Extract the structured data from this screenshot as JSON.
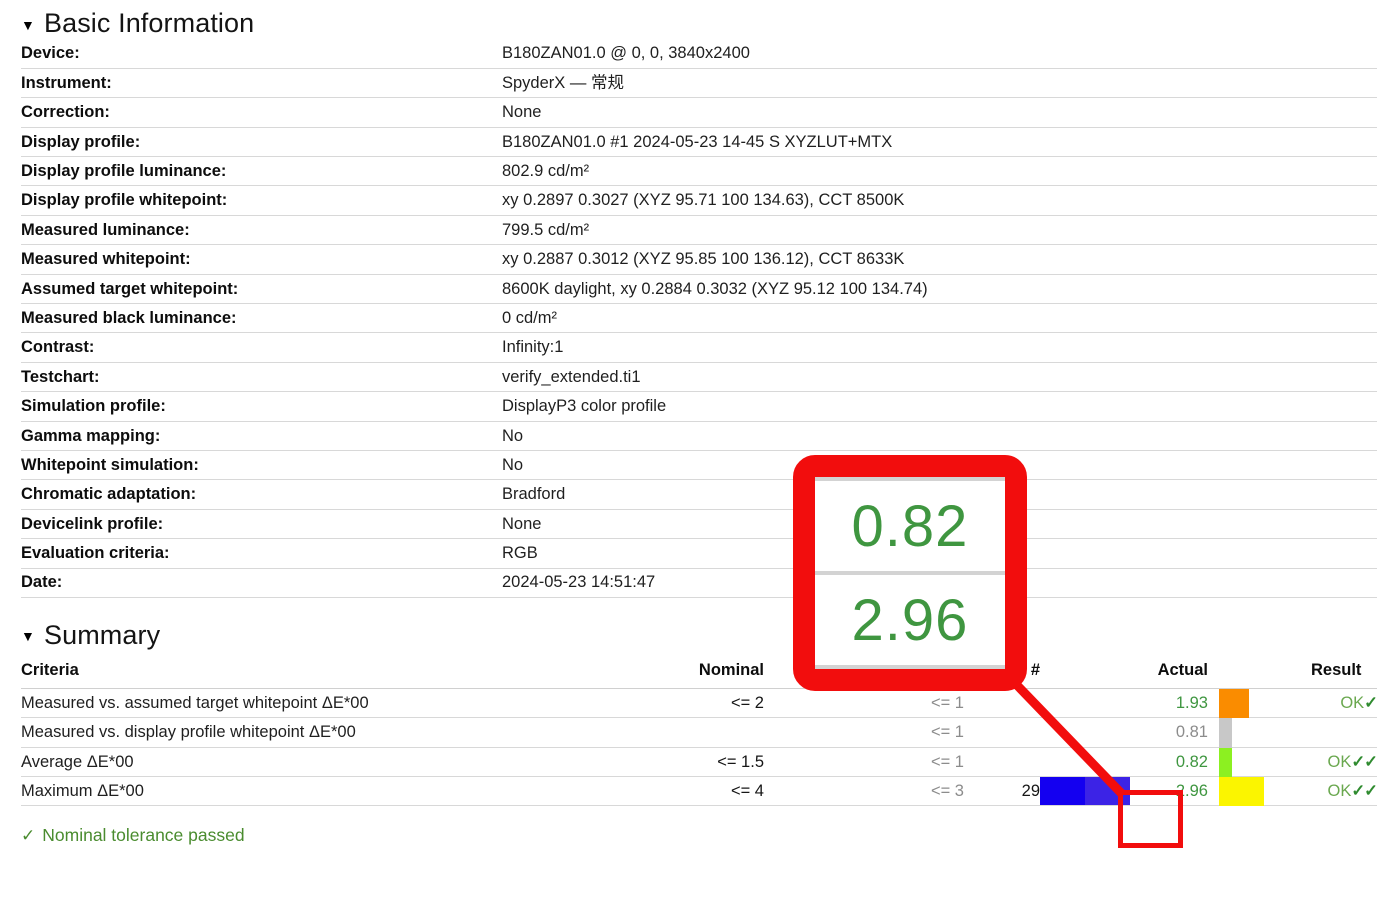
{
  "basic_information": {
    "title": "Basic Information",
    "collapse_icon": "triangle-down-icon",
    "rows": [
      {
        "label": "Device:",
        "value": "B180ZAN01.0 @ 0, 0, 3840x2400"
      },
      {
        "label": "Instrument:",
        "value": "SpyderX — 常规"
      },
      {
        "label": "Correction:",
        "value": "None"
      },
      {
        "label": "Display profile:",
        "value": "B180ZAN01.0 #1 2024-05-23 14-45 S XYZLUT+MTX"
      },
      {
        "label": "Display profile luminance:",
        "value": "802.9 cd/m²"
      },
      {
        "label": "Display profile whitepoint:",
        "value": "xy 0.2897 0.3027 (XYZ 95.71 100 134.63), CCT 8500K"
      },
      {
        "label": "Measured luminance:",
        "value": "799.5 cd/m²"
      },
      {
        "label": "Measured whitepoint:",
        "value": "xy 0.2887 0.3012 (XYZ 95.85 100 136.12), CCT 8633K"
      },
      {
        "label": "Assumed target whitepoint:",
        "value": "8600K daylight, xy 0.2884 0.3032 (XYZ 95.12 100 134.74)"
      },
      {
        "label": "Measured black luminance:",
        "value": "0 cd/m²"
      },
      {
        "label": "Contrast:",
        "value": "Infinity:1"
      },
      {
        "label": "Testchart:",
        "value": "verify_extended.ti1"
      },
      {
        "label": "Simulation profile:",
        "value": "DisplayP3 color profile"
      },
      {
        "label": "Gamma mapping:",
        "value": "No"
      },
      {
        "label": "Whitepoint simulation:",
        "value": "No"
      },
      {
        "label": "Chromatic adaptation:",
        "value": "Bradford"
      },
      {
        "label": "Devicelink profile:",
        "value": "None"
      },
      {
        "label": "Evaluation criteria:",
        "value": "RGB"
      },
      {
        "label": "Date:",
        "value": "2024-05-23 14:51:47"
      }
    ]
  },
  "summary": {
    "title": "Summary",
    "collapse_icon": "triangle-down-icon",
    "columns": {
      "criteria": "Criteria",
      "nominal": "Nominal",
      "recommended": "Recommended",
      "count": "#",
      "actual": "Actual",
      "result": "Result"
    },
    "rows": [
      {
        "criteria": "Measured vs. assumed target whitepoint ΔE*00",
        "nominal": "<= 2",
        "recommended": "<= 1",
        "count": "",
        "actual": "1.93",
        "actual_state": "ok",
        "swatch_color": "#fa8c00",
        "swatch_width": 30,
        "bars": [],
        "result": "OK",
        "checks": "✓"
      },
      {
        "criteria": "Measured vs. display profile whitepoint ΔE*00",
        "nominal": "",
        "recommended": "<= 1",
        "count": "",
        "actual": "0.81",
        "actual_state": "gray",
        "swatch_color": "#c8c8c8",
        "swatch_width": 13,
        "bars": [],
        "result": "",
        "checks": ""
      },
      {
        "criteria": "Average ΔE*00",
        "nominal": "<= 1.5",
        "recommended": "<= 1",
        "count": "",
        "actual": "0.82",
        "actual_state": "ok",
        "swatch_color": "#8cf021",
        "swatch_width": 13,
        "bars": [],
        "result": "OK",
        "checks": "✓✓"
      },
      {
        "criteria": "Maximum ΔE*00",
        "nominal": "<= 4",
        "recommended": "<= 3",
        "count": "29",
        "actual": "2.96",
        "actual_state": "ok",
        "swatch_color": "#fbf500",
        "swatch_width": 45,
        "bars": [
          {
            "color": "#1400f0",
            "width": 45
          },
          {
            "color": "#3c23e6",
            "width": 45
          }
        ],
        "result": "OK",
        "checks": "✓✓"
      }
    ]
  },
  "status": {
    "icon": "check-mark-icon",
    "text": "Nominal tolerance passed",
    "color": "#4a8c2f"
  },
  "callout": {
    "annotation_color": "#f20d0d",
    "magnified_values": [
      "0.82",
      "2.96"
    ]
  }
}
